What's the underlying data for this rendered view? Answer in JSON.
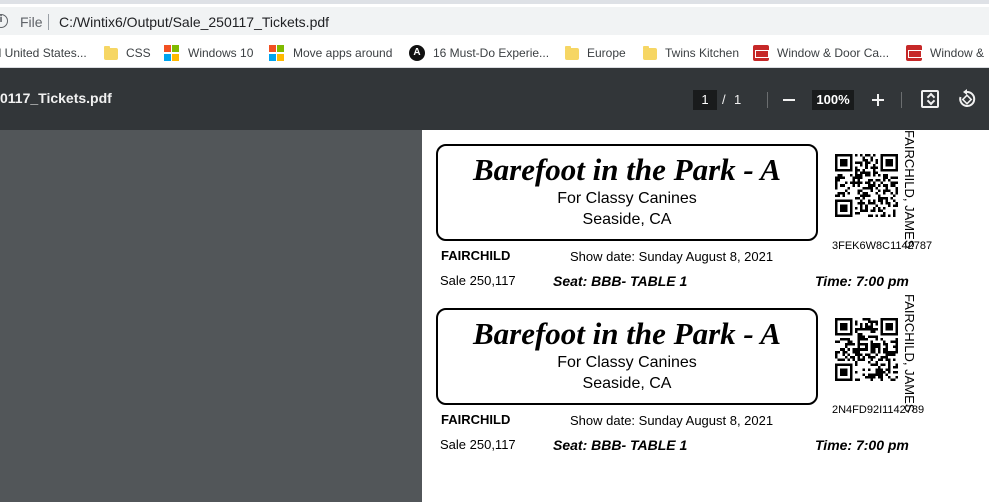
{
  "address_bar": {
    "scheme_label": "File",
    "url": "C:/Wintix6/Output/Sale_250117_Tickets.pdf"
  },
  "bookmarks": [
    {
      "label": "ll United States...",
      "icon": "folder-icon"
    },
    {
      "label": "CSS",
      "icon": "folder-icon"
    },
    {
      "label": "Windows 10",
      "icon": "windows-logo-icon"
    },
    {
      "label": "Move apps around",
      "icon": "windows-logo-icon"
    },
    {
      "label": "16 Must-Do Experie...",
      "icon": "a-logo-icon"
    },
    {
      "label": "Europe",
      "icon": "folder-icon"
    },
    {
      "label": "Twins Kitchen",
      "icon": "folder-icon"
    },
    {
      "label": "Window & Door Ca...",
      "icon": "red-door-logo-icon"
    },
    {
      "label": "Window &",
      "icon": "red-door-logo-icon"
    }
  ],
  "pdf_toolbar": {
    "title": "0117_Tickets.pdf",
    "current_page": "1",
    "page_separator": "/",
    "total_pages": "1",
    "zoom": "100%"
  },
  "tickets": [
    {
      "show_title": "Barefoot in the Park - A",
      "organization": "For Classy Canines",
      "city": "Seaside, CA",
      "buyer_name": "FAIRCHILD",
      "show_date": "Show date: Sunday August  8, 2021",
      "sale": "Sale 250,117",
      "seat": "Seat: BBB-  TABLE 1",
      "time": "Time: 7:00 pm",
      "code": "3FEK6W8C1142787",
      "vertical_name": "FAIRCHILD, JAMES"
    },
    {
      "show_title": "Barefoot in the Park - A",
      "organization": "For Classy Canines",
      "city": "Seaside, CA",
      "buyer_name": "FAIRCHILD",
      "show_date": "Show date: Sunday August  8, 2021",
      "sale": "Sale 250,117",
      "seat": "Seat: BBB-  TABLE 1",
      "time": "Time: 7:00 pm",
      "code": "2N4FD92I1142789",
      "vertical_name": "FAIRCHILD, JAMES"
    }
  ],
  "colors": {
    "toolbar_bg": "#323639",
    "viewer_bg": "#525659",
    "address_pill": "#f1f3f4"
  }
}
